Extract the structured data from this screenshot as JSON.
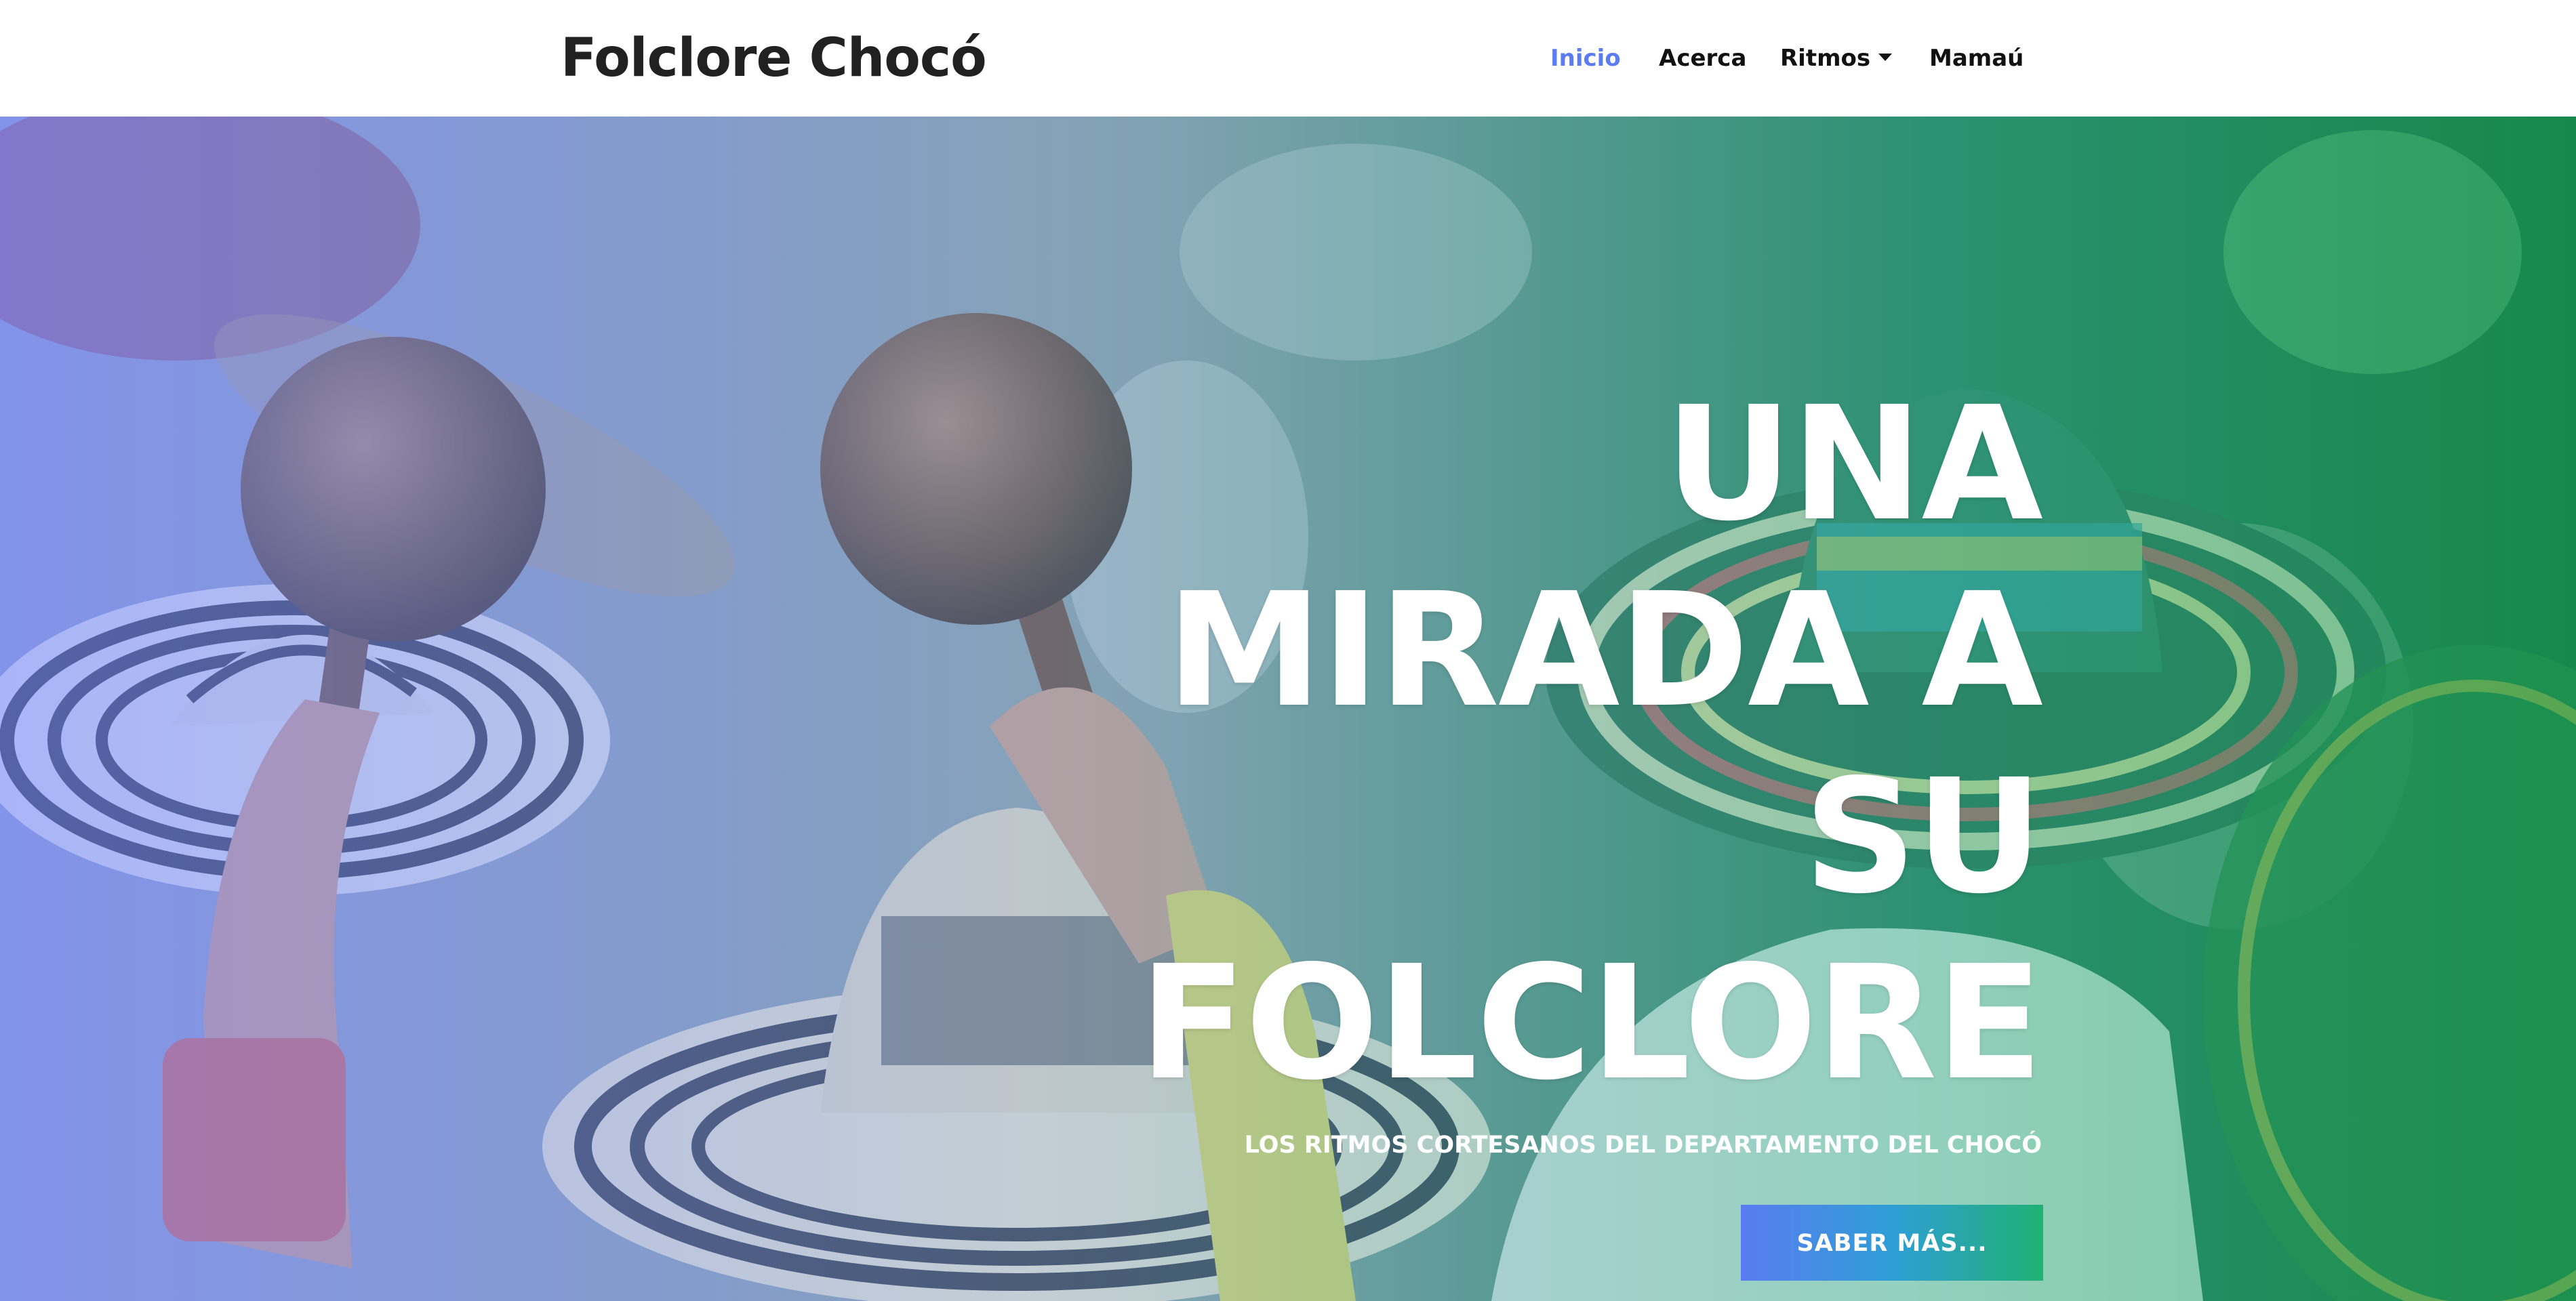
{
  "navbar": {
    "brand": "Folclore Chocó",
    "links": [
      {
        "label": "Inicio",
        "active": true
      },
      {
        "label": "Acerca",
        "active": false
      },
      {
        "label": "Ritmos",
        "active": false,
        "dropdown": true
      },
      {
        "label": "Mamaú",
        "active": false
      }
    ]
  },
  "hero": {
    "title_lines": [
      "UNA",
      "MIRADA A",
      "SU",
      "FOLCLORE"
    ],
    "subtitle": "LOS RITMOS CORTESANOS DEL DEPARTAMENTO DEL CHOCÓ",
    "cta_label": "SABER MÁS..."
  },
  "colors": {
    "accent": "#5b7cf2",
    "cta_gradient_start": "#5a7cf0",
    "cta_gradient_end": "#1fb173",
    "overlay_left": "#7888ff",
    "overlay_right": "#14a05a"
  }
}
